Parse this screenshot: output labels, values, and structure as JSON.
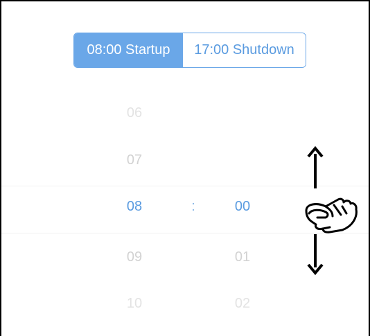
{
  "tabs": [
    {
      "label": "08:00 Startup",
      "active": true
    },
    {
      "label": "17:00 Shutdown",
      "active": false
    }
  ],
  "hours": [
    "06",
    "07",
    "08",
    "09",
    "10"
  ],
  "minutes": [
    "00",
    "01",
    "02"
  ],
  "separator": ":",
  "selected_index": 2,
  "colors": {
    "accent": "#6aa7e8",
    "accent_text": "#5a9be0",
    "faint_text": "#dcdcdc",
    "mid_text": "#cfcfcf"
  },
  "icons": {
    "up": "arrow-up-icon",
    "down": "arrow-down-icon",
    "gesture": "swipe-hand-icon"
  }
}
